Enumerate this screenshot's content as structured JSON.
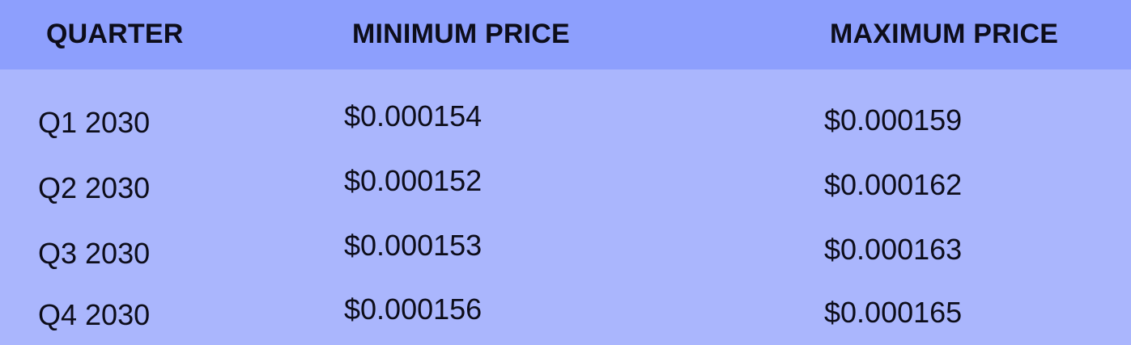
{
  "table": {
    "headers": {
      "quarter": "QUARTER",
      "min_price": "MINIMUM PRICE",
      "max_price": "MAXIMUM PRICE"
    },
    "rows": [
      {
        "quarter": "Q1 2030",
        "min_price": "$0.000154",
        "max_price": "$0.000159"
      },
      {
        "quarter": "Q2 2030",
        "min_price": "$0.000152",
        "max_price": "$0.000162"
      },
      {
        "quarter": "Q3 2030",
        "min_price": "$0.000153",
        "max_price": "$0.000163"
      },
      {
        "quarter": "Q4 2030",
        "min_price": "$0.000156",
        "max_price": "$0.000165"
      }
    ]
  },
  "colors": {
    "header_bg": "#8d9ffd",
    "body_bg": "#aab6fd",
    "text": "#0d0d1a"
  }
}
